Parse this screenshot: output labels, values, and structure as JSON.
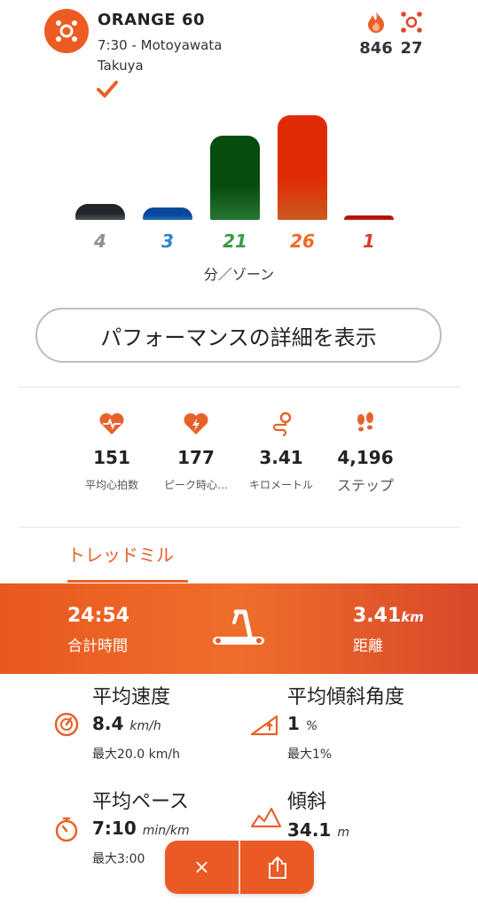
{
  "header": {
    "class_name": "ORANGE 60",
    "time_location": "7:30 - Motoyawata",
    "coach": "Takuya",
    "calories": "846",
    "splat_points": "27"
  },
  "zones": {
    "caption": "分／ゾーン",
    "colors": [
      "#5f6368",
      "#2f86c9",
      "#2e8b3d",
      "#ef6a23",
      "#d93a2b"
    ],
    "label_colors": [
      "#8a929a",
      "#2f86c9",
      "#3b9a48",
      "#ee6a25",
      "#d93a2b"
    ]
  },
  "chart_data": {
    "type": "bar",
    "categories": [
      "gray",
      "blue",
      "green",
      "orange",
      "red"
    ],
    "values": [
      4,
      3,
      21,
      26,
      1
    ],
    "labels": [
      "4",
      "3",
      "21",
      "26",
      "1"
    ]
  },
  "performance_button": "パフォーマンスの詳細を表示",
  "summary": [
    {
      "icon": "heart-rate-icon",
      "value": "151",
      "label": "平均心拍数"
    },
    {
      "icon": "peak-heart-icon",
      "value": "177",
      "label": "ピーク時心…"
    },
    {
      "icon": "route-icon",
      "value": "3.41",
      "label": "キロメートル"
    },
    {
      "icon": "footsteps-icon",
      "value": "4,196",
      "label": "ステップ"
    }
  ],
  "tab": "トレッドミル",
  "treadmill": {
    "total_time": "24:54",
    "total_time_label": "合計時間",
    "distance": "3.41",
    "distance_unit": "km",
    "distance_label": "距離"
  },
  "metrics": {
    "avg_speed": {
      "title": "平均速度",
      "value": "8.4",
      "unit": "km/h",
      "sub": "最大20.0 km/h"
    },
    "avg_incline": {
      "title": "平均傾斜角度",
      "value": "1",
      "unit": "%",
      "sub": "最大1%"
    },
    "avg_pace": {
      "title": "平均ペース",
      "value": "7:10",
      "unit": "min/km",
      "sub": "最大3:00"
    },
    "elevation": {
      "title": "傾斜",
      "value": "34.1",
      "unit": "m"
    }
  },
  "actions": {
    "close": "×"
  }
}
